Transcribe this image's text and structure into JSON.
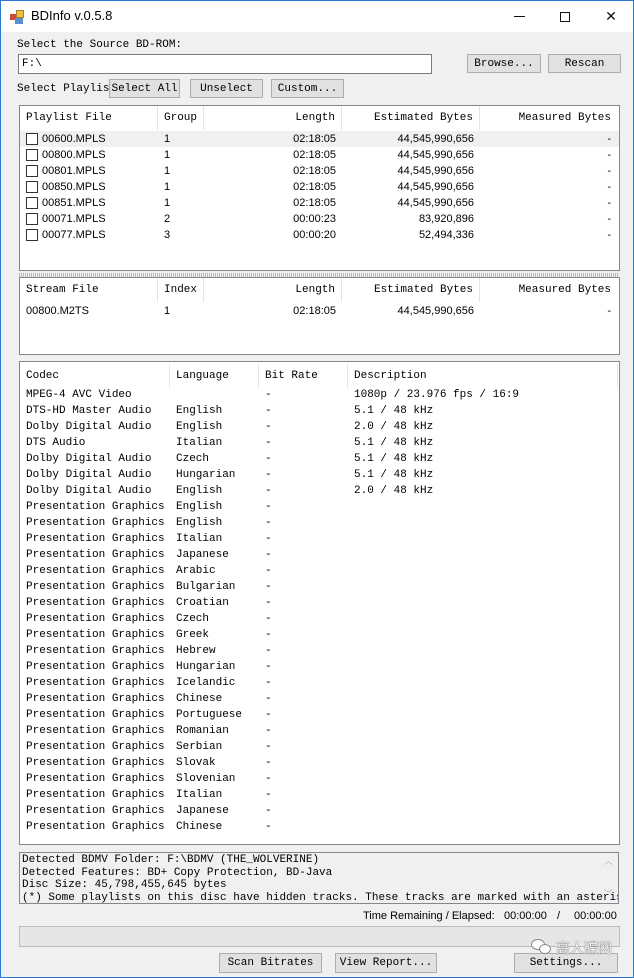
{
  "window": {
    "title": "BDInfo v.0.5.8",
    "icon": "bdinfo-app-icon",
    "controls": {
      "minimize": "minimize-icon",
      "maximize": "maximize-icon",
      "close": "close-icon"
    }
  },
  "source": {
    "label": "Select the Source BD-ROM:",
    "path_value": "F:\\",
    "browse_label": "Browse...",
    "rescan_label": "Rescan"
  },
  "playlist_controls": {
    "label": "Select Playlist",
    "select_all_label": "Select All",
    "unselect_label": "Unselect",
    "custom_label": "Custom..."
  },
  "playlists": {
    "columns": [
      "Playlist File",
      "Group",
      "Length",
      "Estimated Bytes",
      "Measured Bytes"
    ],
    "rows": [
      {
        "file": "00600.MPLS",
        "group": "1",
        "length": "02:18:05",
        "estimated": "44,545,990,656",
        "measured": "-",
        "checked": false
      },
      {
        "file": "00800.MPLS",
        "group": "1",
        "length": "02:18:05",
        "estimated": "44,545,990,656",
        "measured": "-",
        "checked": false
      },
      {
        "file": "00801.MPLS",
        "group": "1",
        "length": "02:18:05",
        "estimated": "44,545,990,656",
        "measured": "-",
        "checked": false
      },
      {
        "file": "00850.MPLS",
        "group": "1",
        "length": "02:18:05",
        "estimated": "44,545,990,656",
        "measured": "-",
        "checked": false
      },
      {
        "file": "00851.MPLS",
        "group": "1",
        "length": "02:18:05",
        "estimated": "44,545,990,656",
        "measured": "-",
        "checked": false
      },
      {
        "file": "00071.MPLS",
        "group": "2",
        "length": "00:00:23",
        "estimated": "83,920,896",
        "measured": "-",
        "checked": false
      },
      {
        "file": "00077.MPLS",
        "group": "3",
        "length": "00:00:20",
        "estimated": "52,494,336",
        "measured": "-",
        "checked": false
      }
    ]
  },
  "streams": {
    "columns": [
      "Stream File",
      "Index",
      "Length",
      "Estimated Bytes",
      "Measured Bytes"
    ],
    "rows": [
      {
        "file": "00800.M2TS",
        "index": "1",
        "length": "02:18:05",
        "estimated": "44,545,990,656",
        "measured": "-"
      }
    ]
  },
  "codecs": {
    "columns": [
      "Codec",
      "Language",
      "Bit Rate",
      "Description"
    ],
    "rows": [
      {
        "codec": "MPEG-4 AVC Video",
        "language": "",
        "bitrate": "-",
        "description": "1080p / 23.976 fps / 16:9"
      },
      {
        "codec": "DTS-HD Master Audio",
        "language": "English",
        "bitrate": "-",
        "description": "5.1 / 48 kHz"
      },
      {
        "codec": "Dolby Digital Audio",
        "language": "English",
        "bitrate": "-",
        "description": "2.0 / 48 kHz"
      },
      {
        "codec": "DTS Audio",
        "language": "Italian",
        "bitrate": "-",
        "description": "5.1 / 48 kHz"
      },
      {
        "codec": "Dolby Digital Audio",
        "language": "Czech",
        "bitrate": "-",
        "description": "5.1 / 48 kHz"
      },
      {
        "codec": "Dolby Digital Audio",
        "language": "Hungarian",
        "bitrate": "-",
        "description": "5.1 / 48 kHz"
      },
      {
        "codec": "Dolby Digital Audio",
        "language": "English",
        "bitrate": "-",
        "description": "2.0 / 48 kHz"
      },
      {
        "codec": "Presentation Graphics",
        "language": "English",
        "bitrate": "-",
        "description": ""
      },
      {
        "codec": "Presentation Graphics",
        "language": "English",
        "bitrate": "-",
        "description": ""
      },
      {
        "codec": "Presentation Graphics",
        "language": "Italian",
        "bitrate": "-",
        "description": ""
      },
      {
        "codec": "Presentation Graphics",
        "language": "Japanese",
        "bitrate": "-",
        "description": ""
      },
      {
        "codec": "Presentation Graphics",
        "language": "Arabic",
        "bitrate": "-",
        "description": ""
      },
      {
        "codec": "Presentation Graphics",
        "language": "Bulgarian",
        "bitrate": "-",
        "description": ""
      },
      {
        "codec": "Presentation Graphics",
        "language": "Croatian",
        "bitrate": "-",
        "description": ""
      },
      {
        "codec": "Presentation Graphics",
        "language": "Czech",
        "bitrate": "-",
        "description": ""
      },
      {
        "codec": "Presentation Graphics",
        "language": "Greek",
        "bitrate": "-",
        "description": ""
      },
      {
        "codec": "Presentation Graphics",
        "language": "Hebrew",
        "bitrate": "-",
        "description": ""
      },
      {
        "codec": "Presentation Graphics",
        "language": "Hungarian",
        "bitrate": "-",
        "description": ""
      },
      {
        "codec": "Presentation Graphics",
        "language": "Icelandic",
        "bitrate": "-",
        "description": ""
      },
      {
        "codec": "Presentation Graphics",
        "language": "Chinese",
        "bitrate": "-",
        "description": ""
      },
      {
        "codec": "Presentation Graphics",
        "language": "Portuguese",
        "bitrate": "-",
        "description": ""
      },
      {
        "codec": "Presentation Graphics",
        "language": "Romanian",
        "bitrate": "-",
        "description": ""
      },
      {
        "codec": "Presentation Graphics",
        "language": "Serbian",
        "bitrate": "-",
        "description": ""
      },
      {
        "codec": "Presentation Graphics",
        "language": "Slovak",
        "bitrate": "-",
        "description": ""
      },
      {
        "codec": "Presentation Graphics",
        "language": "Slovenian",
        "bitrate": "-",
        "description": ""
      },
      {
        "codec": "Presentation Graphics",
        "language": "Italian",
        "bitrate": "-",
        "description": ""
      },
      {
        "codec": "Presentation Graphics",
        "language": "Japanese",
        "bitrate": "-",
        "description": ""
      },
      {
        "codec": "Presentation Graphics",
        "language": "Chinese",
        "bitrate": "-",
        "description": ""
      }
    ]
  },
  "info": {
    "lines": [
      "Detected BDMV Folder: F:\\BDMV (THE_WOLVERINE)",
      "Detected Features: BD+ Copy Protection, BD-Java",
      "Disc Size: 45,798,455,645 bytes",
      "(*) Some playlists on this disc have hidden tracks. These tracks are marked with an asterisk."
    ]
  },
  "progress": {
    "time_label": "Time Remaining / Elapsed:",
    "remaining": "00:00:00",
    "separator": "/",
    "elapsed": "00:00:00",
    "percent": 0
  },
  "actions": {
    "scan_bitrates_label": "Scan Bitrates",
    "view_report_label": "View Report...",
    "settings_label": "Settings..."
  },
  "watermark": {
    "text": "高人碟网",
    "icon": "wechat-icon"
  }
}
